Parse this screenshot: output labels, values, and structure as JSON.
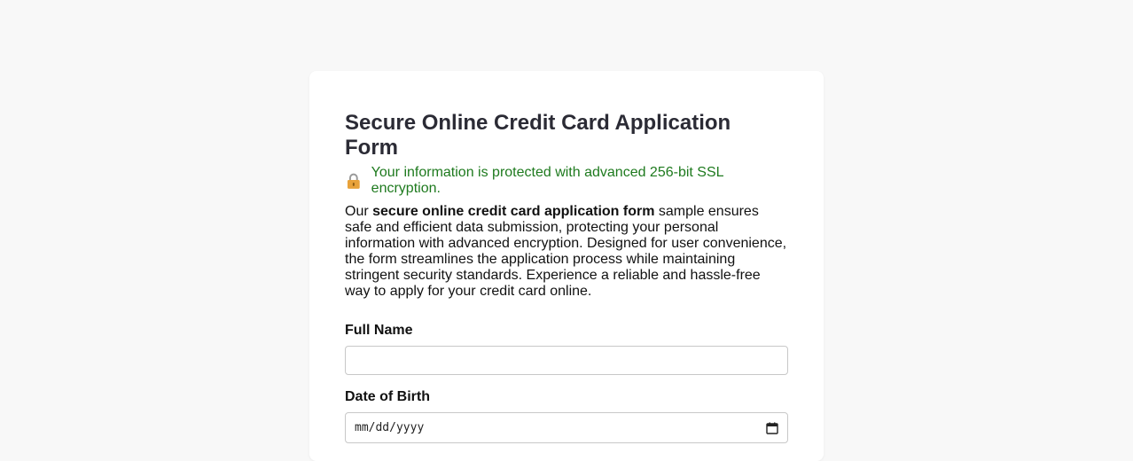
{
  "form": {
    "title": "Secure Online Credit Card Application Form",
    "security_note": "Your information is protected with advanced 256-bit SSL encryption.",
    "lock_icon": "lock-icon",
    "description": {
      "prefix": "Our ",
      "bold": "secure online credit card application form",
      "suffix": " sample ensures safe and efficient data submission, protecting your personal information with advanced encryption. Designed for user convenience, the form streamlines the application process while maintaining stringent security standards. Experience a reliable and hassle-free way to apply for your credit card online."
    },
    "fields": {
      "full_name": {
        "label": "Full Name",
        "value": "",
        "placeholder": ""
      },
      "dob": {
        "label": "Date of Birth",
        "placeholder": "mm/dd/yyyy",
        "icon": "calendar-icon"
      }
    }
  },
  "colors": {
    "page_bg": "#f8f8f8",
    "card_bg": "#ffffff",
    "title": "#2b2b35",
    "secure_green": "#1e7a1e",
    "lock_gold": "#e8a23a"
  }
}
